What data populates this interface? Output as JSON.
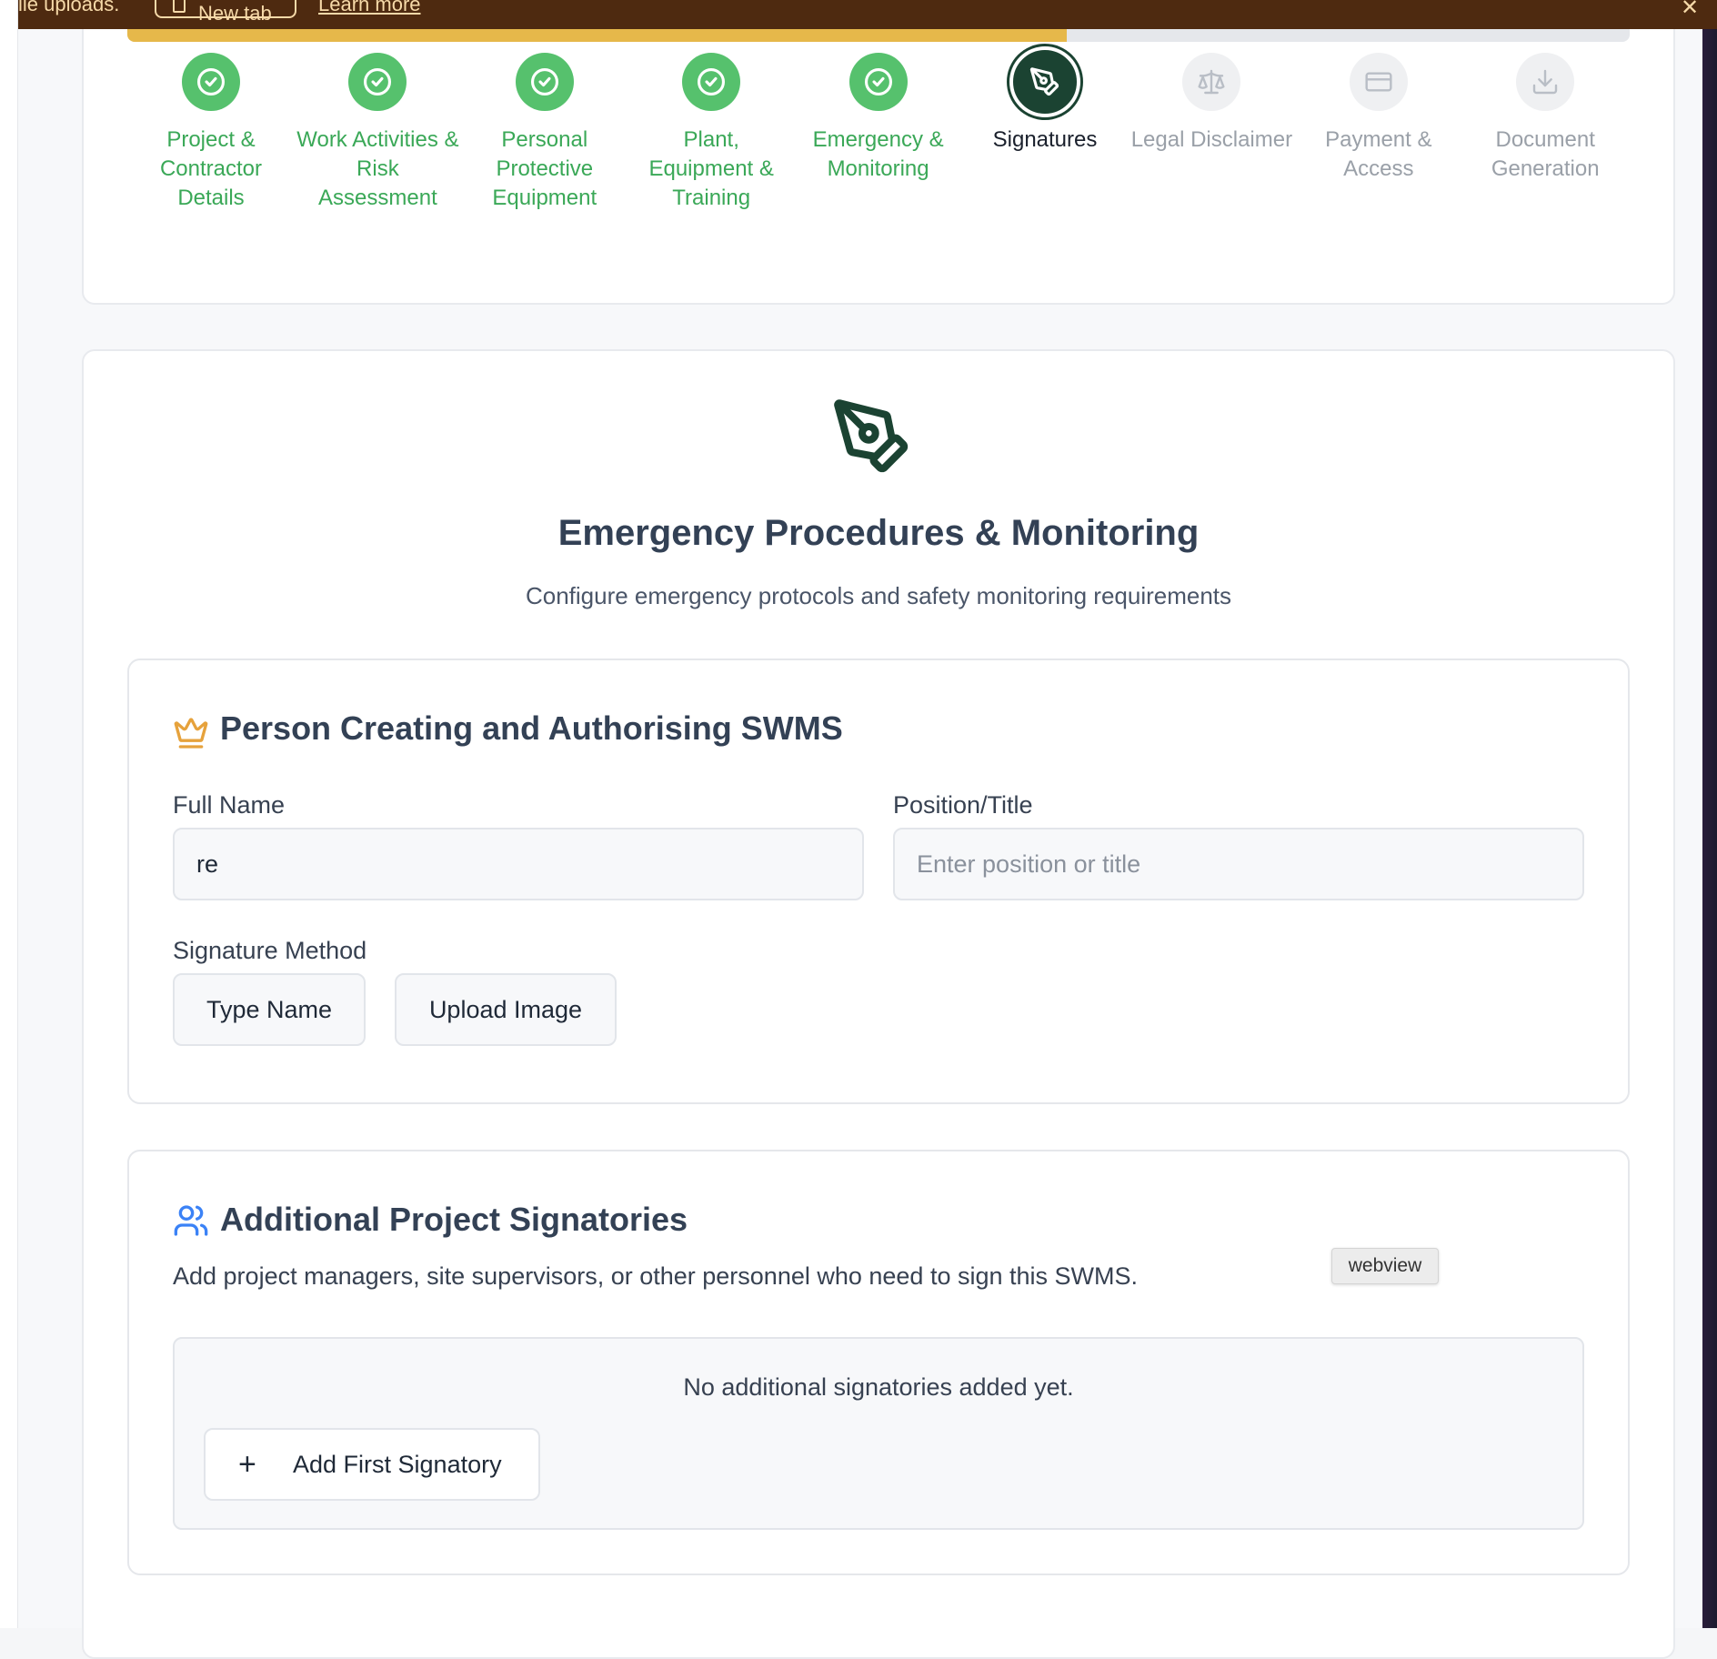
{
  "banner": {
    "message": "ile uploads.",
    "new_tab_label": "New tab",
    "learn_more_label": "Learn more",
    "close_icon": "close-icon"
  },
  "progress": {
    "fraction": 0.625,
    "color": "#e6b84a"
  },
  "steps": [
    {
      "label": "Project & Contractor Details",
      "status": "done"
    },
    {
      "label": "Work Activities & Risk Assessment",
      "status": "done"
    },
    {
      "label": "Personal Protective Equipment",
      "status": "done"
    },
    {
      "label": "Plant, Equipment & Training",
      "status": "done"
    },
    {
      "label": "Emergency & Monitoring",
      "status": "done"
    },
    {
      "label": "Signatures",
      "status": "active"
    },
    {
      "label": "Legal Disclaimer",
      "status": "pending"
    },
    {
      "label": "Payment & Access",
      "status": "pending"
    },
    {
      "label": "Document Generation",
      "status": "pending"
    }
  ],
  "hero": {
    "icon": "pen-tool-icon",
    "title": "Emergency Procedures & Monitoring",
    "subtitle": "Configure emergency protocols and safety monitoring requirements"
  },
  "creator_section": {
    "icon": "crown-icon",
    "title": "Person Creating and Authorising SWMS",
    "full_name_label": "Full Name",
    "full_name_value": "re",
    "position_label": "Position/Title",
    "position_placeholder": "Enter position or title",
    "signature_method_label": "Signature Method",
    "type_name_button": "Type Name",
    "upload_image_button": "Upload Image"
  },
  "signatories_section": {
    "icon": "users-icon",
    "title": "Additional Project Signatories",
    "description": "Add project managers, site supervisors, or other personnel who need to sign this SWMS.",
    "empty_text": "No additional signatories added yet.",
    "add_button": "Add First Signatory",
    "tooltip": "webview"
  },
  "colors": {
    "done": "#56c16d",
    "active": "#1b4332",
    "banner": "#4e2a10",
    "crown": "#e6a23c",
    "users": "#3b82f6"
  }
}
